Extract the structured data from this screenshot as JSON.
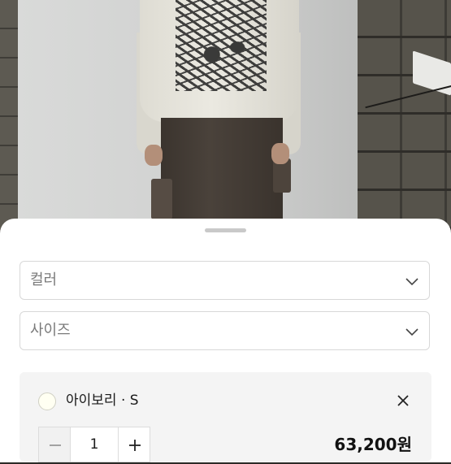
{
  "product_image": {
    "icon": "product-photo"
  },
  "sheet": {
    "selects": [
      {
        "label": "컬러",
        "icon": "chevron-down-icon"
      },
      {
        "label": "사이즈",
        "icon": "chevron-down-icon"
      }
    ],
    "selected_option": {
      "name": "아이보리 · S",
      "swatch_color": "#fffff2",
      "quantity": "1",
      "price": "63,200원"
    }
  },
  "colors": {
    "sheet_bg": "#ffffff",
    "card_bg": "#f4f4f4",
    "border": "#d8d8d8"
  }
}
